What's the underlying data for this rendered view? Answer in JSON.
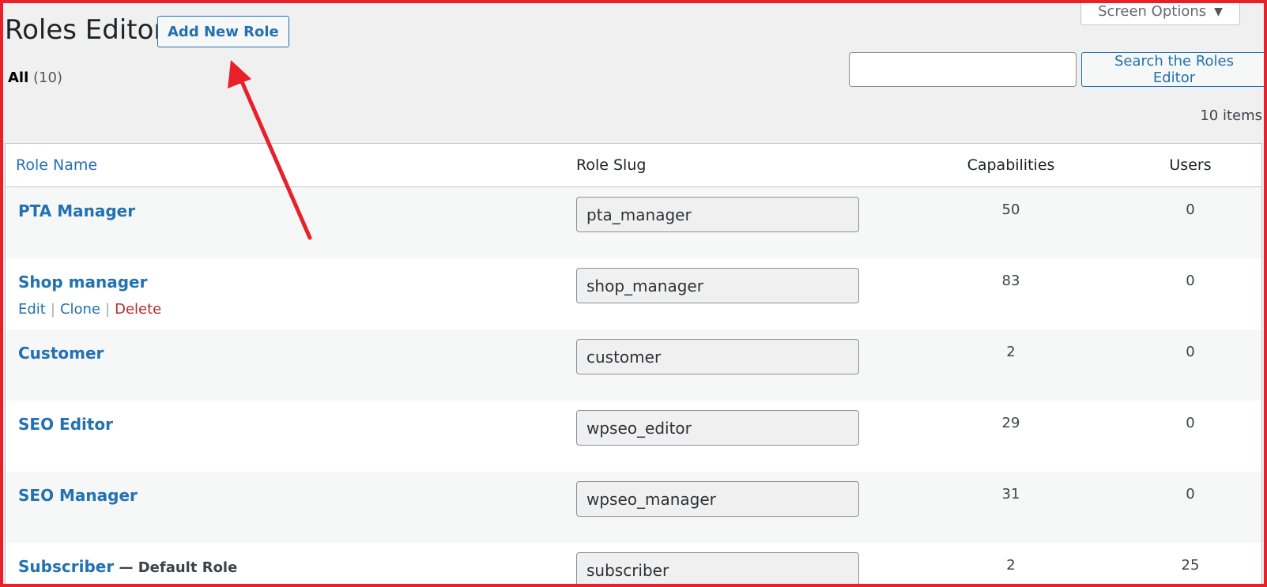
{
  "screen_options": {
    "label": "Screen Options",
    "icon": "triangle-down-icon"
  },
  "header": {
    "title": "Roles Editor",
    "add_new_label": "Add New Role"
  },
  "filter": {
    "label": "All",
    "count": "(10)"
  },
  "search": {
    "value": "",
    "button_label": "Search the Roles Editor"
  },
  "items_count": "10 items",
  "table": {
    "columns": {
      "name": "Role Name",
      "slug": "Role Slug",
      "capabilities": "Capabilities",
      "users": "Users"
    },
    "rows": [
      {
        "name": "PTA Manager",
        "suffix": "",
        "slug": "pta_manager",
        "capabilities": "50",
        "users": "0"
      },
      {
        "name": "Shop manager",
        "suffix": "",
        "slug": "shop_manager",
        "capabilities": "83",
        "users": "0",
        "actions": {
          "edit": "Edit",
          "clone": "Clone",
          "delete": "Delete",
          "separator": "|"
        }
      },
      {
        "name": "Customer",
        "suffix": "",
        "slug": "customer",
        "capabilities": "2",
        "users": "0"
      },
      {
        "name": "SEO Editor",
        "suffix": "",
        "slug": "wpseo_editor",
        "capabilities": "29",
        "users": "0"
      },
      {
        "name": "SEO Manager",
        "suffix": "",
        "slug": "wpseo_manager",
        "capabilities": "31",
        "users": "0"
      },
      {
        "name": "Subscriber",
        "suffix": " — Default Role",
        "slug": "subscriber",
        "capabilities": "2",
        "users": "25"
      }
    ]
  },
  "annotation": {
    "arrow_color": "#e8202a"
  }
}
